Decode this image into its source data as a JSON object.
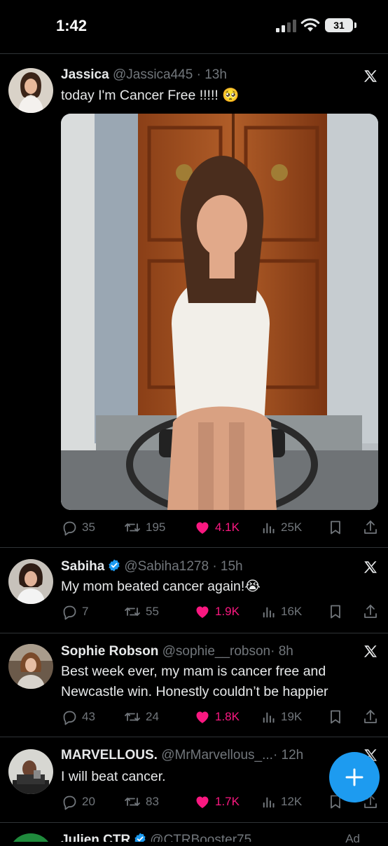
{
  "status_bar": {
    "time": "1:42",
    "battery": "31"
  },
  "tweets": [
    {
      "name": "Jassica",
      "handle": "@Jassica445",
      "time": "· 13h",
      "verified": false,
      "text": "today I'm Cancer Free !!!!! 🥺",
      "replies": "35",
      "retweets": "195",
      "likes": "4.1K",
      "views": "25K"
    },
    {
      "name": "Sabiha",
      "handle": "@Sabiha1278",
      "time": "· 15h",
      "verified": true,
      "text": "My mom beated cancer again!😭",
      "replies": "7",
      "retweets": "55",
      "likes": "1.9K",
      "views": "16K"
    },
    {
      "name": "Sophie Robson",
      "handle": "@sophie__robson",
      "time": "· 8h",
      "verified": false,
      "text": "Best week ever, my mam is cancer free and Newcastle win. Honestly couldn’t be happier",
      "replies": "43",
      "retweets": "24",
      "likes": "1.8K",
      "views": "19K"
    },
    {
      "name": "MARVELLOUS.",
      "handle": "@MrMarvellous_...",
      "time": "· 12h",
      "verified": false,
      "text": "I will beat cancer.",
      "replies": "20",
      "retweets": "83",
      "likes": "1.7K",
      "views": "12K"
    },
    {
      "name": "Julien CTR",
      "handle": "@CTRBooster75",
      "verified": true,
      "ad_label": "Ad"
    }
  ],
  "colors": {
    "accent": "#1d9bf0",
    "like": "#f91880",
    "muted": "#71767b",
    "text": "#e7e9ea",
    "divider": "#2f3336"
  },
  "icons": [
    "reply-icon",
    "retweet-icon",
    "like-icon",
    "views-icon",
    "bookmark-icon",
    "share-icon",
    "x-logo-icon",
    "compose-plus-icon",
    "verified-badge-icon"
  ]
}
